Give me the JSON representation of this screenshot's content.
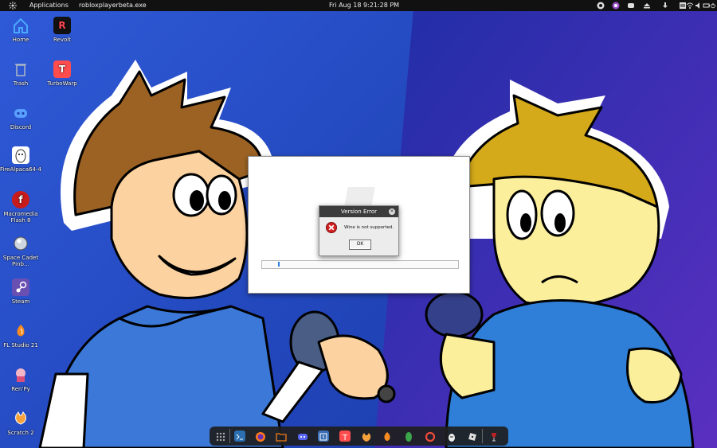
{
  "top_panel": {
    "applications_label": "Applications",
    "window_title": "robloxplayerbeta.exe",
    "clock": "Fri Aug 18   9:21:28 PM",
    "tray_icons": [
      "steam-icon",
      "obs-icon",
      "discord-icon",
      "eject-icon",
      "download-icon",
      "notes-icon",
      "wifi-icon",
      "speaker-icon",
      "battery-icon",
      "power-icon"
    ]
  },
  "desktop": {
    "icons": [
      {
        "name": "home",
        "label": "Home",
        "icon": "home-icon",
        "color": "#3d9cf0"
      },
      {
        "name": "revolt",
        "label": "Revolt",
        "icon": "revolt-icon",
        "color": "#ff4654",
        "letter": "R"
      },
      {
        "name": "trash",
        "label": "Trash",
        "icon": "trash-icon",
        "color": "#aeb8c6"
      },
      {
        "name": "turbowarp",
        "label": "TurboWarp",
        "icon": "turbowarp-icon",
        "color": "#ff4c4c",
        "letter": "T"
      },
      {
        "name": "discord",
        "label": "Discord",
        "icon": "discord-icon",
        "color": "#5865f2"
      },
      {
        "name": "firealpaca",
        "label": "FireAlpaca64-4",
        "icon": "firealpaca-icon",
        "color": "#fff"
      },
      {
        "name": "macromedia-flash",
        "label": "Macromedia Flash 8",
        "icon": "flash-icon",
        "color": "#d22"
      },
      {
        "name": "space-cadet",
        "label": "Space Cadet Pinb…",
        "icon": "pinball-icon",
        "color": "#ccc"
      },
      {
        "name": "steam",
        "label": "Steam",
        "icon": "steam-icon",
        "color": "#6a4fb3"
      },
      {
        "name": "fl-studio",
        "label": "FL Studio 21",
        "icon": "fl-studio-icon",
        "color": "#f68b1f"
      },
      {
        "name": "ren",
        "label": "Ren'Py",
        "icon": "renpy-icon",
        "color": "#f5b6c8"
      },
      {
        "name": "scratch",
        "label": "Scratch 2",
        "icon": "scratch-icon",
        "color": "#f7a13a"
      }
    ]
  },
  "installer": {
    "progress": 0.08
  },
  "error_dialog": {
    "title": "Version Error",
    "message": "Wine is not supported.",
    "ok_label": "OK",
    "icon": "error-icon",
    "close_icon": "close-icon"
  },
  "dock": {
    "items": [
      {
        "name": "app-grid",
        "icon": "app-grid-icon",
        "color": "#888"
      },
      {
        "name": "terminal",
        "icon": "terminal-icon",
        "color": "#2b6fb0"
      },
      {
        "name": "firefox",
        "icon": "firefox-icon",
        "color": "#ff7a1a"
      },
      {
        "name": "files",
        "icon": "folder-icon",
        "color": "#f07a1a"
      },
      {
        "name": "discord",
        "icon": "discord-icon",
        "color": "#5865f2"
      },
      {
        "name": "obs",
        "icon": "obs-icon",
        "color": "#3a6eb5"
      },
      {
        "name": "turbowarp",
        "icon": "turbowarp-icon",
        "color": "#ff4c4c"
      },
      {
        "name": "scratch",
        "icon": "scratch-icon",
        "color": "#f7a13a"
      },
      {
        "name": "fl-studio",
        "icon": "fl-studio-icon",
        "color": "#f68b1f"
      },
      {
        "name": "green-app",
        "icon": "leaf-icon",
        "color": "#3aa54a"
      },
      {
        "name": "anydesk",
        "icon": "anydesk-icon",
        "color": "#ef4b3a"
      },
      {
        "name": "firealpaca",
        "icon": "firealpaca-icon",
        "color": "#eee"
      },
      {
        "name": "roblox",
        "icon": "roblox-icon",
        "color": "#ddd"
      },
      {
        "name": "wine",
        "icon": "wine-icon",
        "color": "#b22"
      }
    ]
  }
}
